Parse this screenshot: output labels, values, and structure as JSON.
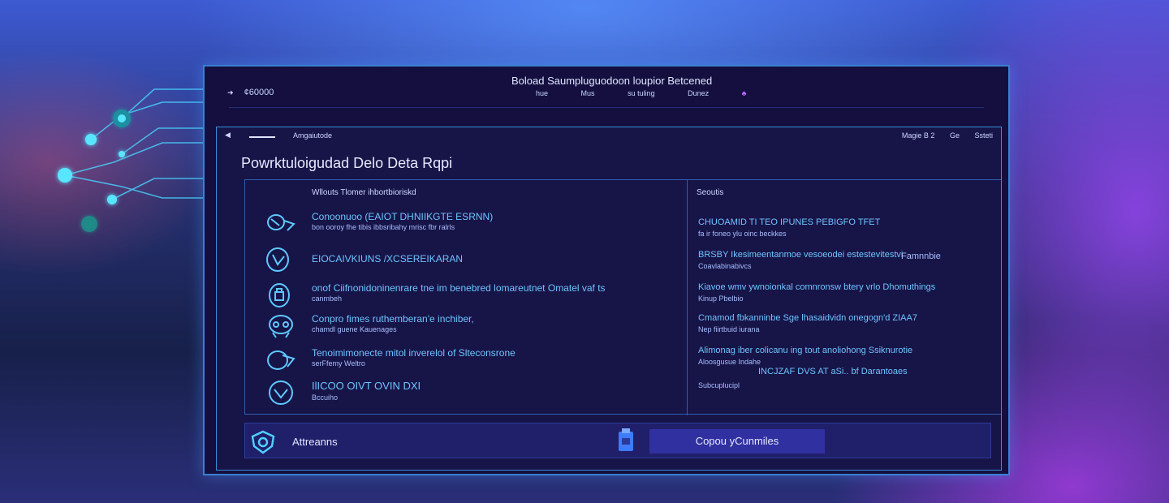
{
  "colors": {
    "accent": "#3a8fd8",
    "link": "#6ec4ff",
    "window_bg": "#140f3f",
    "button_bg": "#3130a0"
  },
  "window": {
    "left_label": "¢60000",
    "title": "Boload Saumpluguodoon loupior Betcened",
    "menu": [
      "hue",
      "Mus",
      "su tuling",
      "Dunez"
    ],
    "menu_marker": "♣"
  },
  "panel": {
    "toolbar": {
      "back": "◀",
      "address": "Amgaiutode",
      "right": [
        "Magie B 2",
        "Ge",
        "Ssteti"
      ]
    },
    "title": "Powrktuloigudad Delo Deta Rqpi",
    "left": {
      "heading": "Wllouts Tlomer ihbortbioriskd",
      "items": [
        {
          "icon": "glasses-icon",
          "line1": "Conoonuoo (EAIOT DHNIIKGTE ESRNN)",
          "line2": "bon ooroy fhe tibis ibbsribahy mrisc fbr ralrls"
        },
        {
          "icon": "shield-icon",
          "line1": "EIOCAIVKIUNS /XCSEREIKARAN",
          "line2": ""
        },
        {
          "icon": "lock-icon",
          "line1": "onof Ciifnonidoninenrare tne im benebred lomareutnet Omatel vaf ts",
          "line2": "canmbeh"
        },
        {
          "icon": "robot-icon",
          "line1": "Conpro fimes ruthemberan'e inchiber,",
          "line2": "chamdl guene Kauenages"
        },
        {
          "icon": "glasses-icon",
          "line1": "Tenoimimonecte mitol inverelol of Slteconsrone",
          "line2": "serFfemy Weltro"
        },
        {
          "icon": "face-icon",
          "line1": "IlICOO OIVT OVIN DXI",
          "line2": "Bccuiho"
        }
      ]
    },
    "right": {
      "heading": "Seoutis",
      "items": [
        {
          "line1": "CHUOAMID TI TEO IPUNES PEBIGFO TFET",
          "line2": "fa ir foneo ylu oinc beckkes",
          "aside": ""
        },
        {
          "line1": "BRSBY Ikesimeentanmoe vesoeodei estestevitestvi",
          "line2": "Coavlabinabivcs",
          "aside": "Famnnbie"
        },
        {
          "line1": "Kiavoe wmv ywnoionkal comnronsw btery vrlo Dhomuthings",
          "line2": "Kinup Pbelbio",
          "aside": ""
        },
        {
          "line1": "Cmamod fbkanninbe Sge lhasaidvidn onegogn'd ZIAA7",
          "line2": "Nep fiirtbuid iurana",
          "aside": ""
        },
        {
          "line1": "Alimonag iber colicanu ing tout anoliohong Ssiknurotie",
          "line2": "Aloosgusue Indahe",
          "aside": ""
        },
        {
          "line1": "Subcuplucipl",
          "line2": "",
          "aside": "INCJZAF DVS AT aSi.. bf Darantoaes"
        }
      ]
    },
    "footer": {
      "left_label": "Attreanns",
      "button_label": "Copou yCunmiles"
    }
  }
}
